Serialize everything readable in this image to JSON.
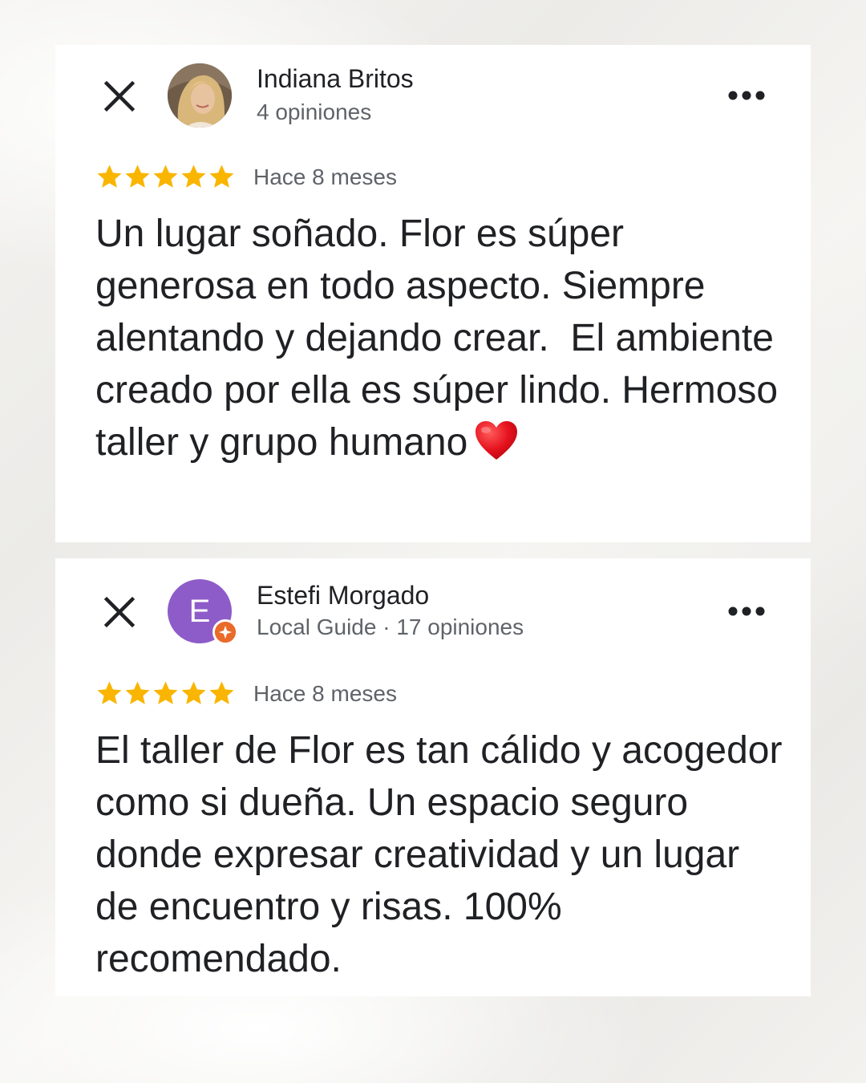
{
  "colors": {
    "star": "#f9b500",
    "avatar_purple": "#8e5cc9",
    "guide_badge": "#ea6a2a",
    "heart": "#e5121d"
  },
  "reviews": [
    {
      "author_name": "Indiana Britos",
      "author_meta": "4 opiniones",
      "avatar": "photo",
      "rating": 5,
      "date": "Hace 8 meses",
      "text": "Un lugar soñado. Flor es súper generosa en todo aspecto. Siempre alentando y dejando crear.  El ambiente creado por ella es súper lindo. Hermoso taller y grupo humano",
      "emoji": "heart-icon"
    },
    {
      "author_name": "Estefi Morgado",
      "author_meta": "Local Guide · 17 opiniones",
      "avatar_letter": "E",
      "rating": 5,
      "date": "Hace 8 meses",
      "text": "El taller de Flor es tan cálido y acogedor como si dueña. Un espacio seguro donde expresar creatividad y un lugar de encuentro y risas. 100% recomendado."
    }
  ]
}
